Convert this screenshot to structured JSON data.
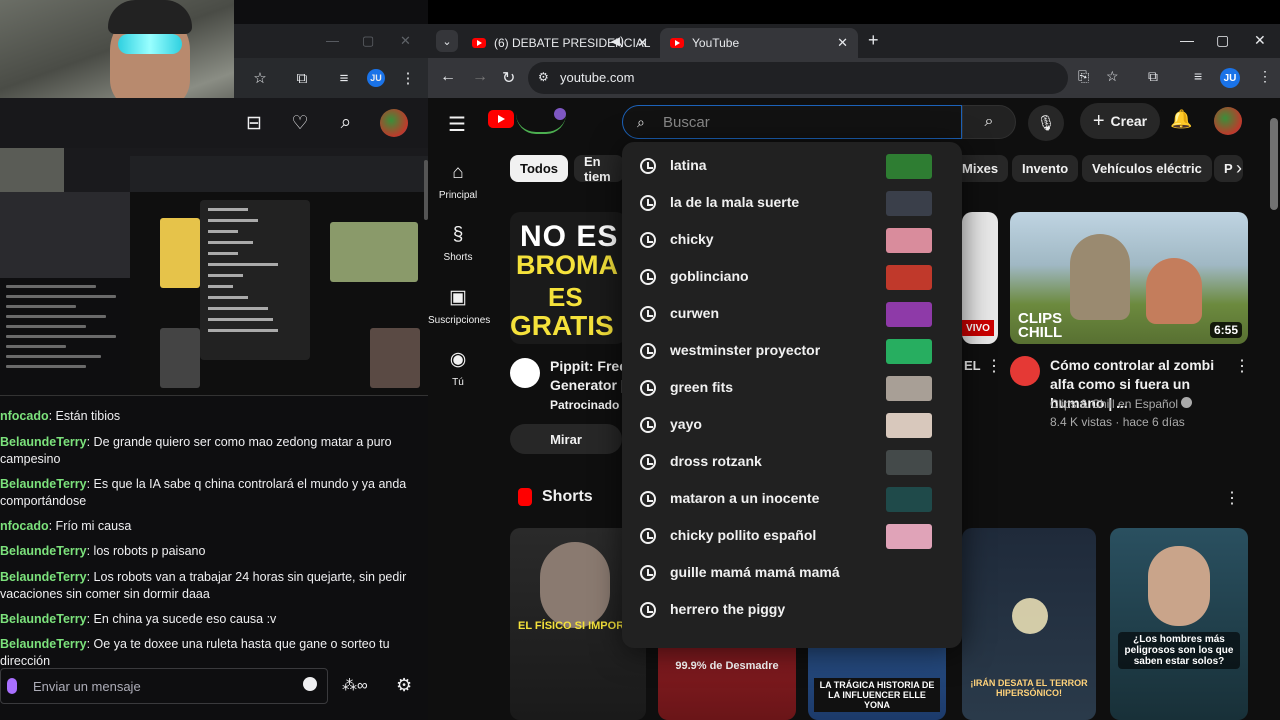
{
  "left": {
    "tabbar_controls": [
      "—",
      "▢",
      "✕"
    ],
    "toolbar_profile": "JU",
    "chat": [
      {
        "user": "nfocado",
        "text": ": Están tibios"
      },
      {
        "user": "BelaundeTerry",
        "text": ": De grande quiero ser como mao zedong matar a puro campesino"
      },
      {
        "user": "BelaundeTerry",
        "text": ": Es que la IA sabe q china controlará el mundo y ya anda comportándose"
      },
      {
        "user": "nfocado",
        "text": ": Frío mi causa"
      },
      {
        "user": "BelaundeTerry",
        "text": ": los robots p paisano"
      },
      {
        "user": "BelaundeTerry",
        "text": ": Los robots van a trabajar 24 horas sin quejarte, sin pedir vacaciones sin comer sin dormir daaa"
      },
      {
        "user": "BelaundeTerry",
        "text": ": En china ya sucede eso causa :v"
      },
      {
        "user": "BelaundeTerry",
        "text": ": Oe ya te doxee una ruleta hasta que gane o sorteo tu dirección"
      }
    ],
    "chat_placeholder": "Enviar un mensaje"
  },
  "browser": {
    "tabs": [
      {
        "title": "(6) DEBATE PRESIDENCIAL",
        "active": false
      },
      {
        "title": "YouTube",
        "active": true
      }
    ],
    "url": "youtube.com",
    "profile": "JU"
  },
  "youtube": {
    "search_placeholder": "Buscar",
    "crear_label": "Crear",
    "guide": [
      {
        "icon": "home-icon",
        "label": "Principal"
      },
      {
        "icon": "shorts-icon",
        "label": "Shorts"
      },
      {
        "icon": "subscriptions-icon",
        "label": "Suscripciones"
      },
      {
        "icon": "you-icon",
        "label": "Tú"
      }
    ],
    "chips": {
      "first": "Todos",
      "second": "En tiem",
      "mixes": "Mixes",
      "invento": "Invento",
      "vehiculos": "Vehículos eléctric",
      "last": "P"
    },
    "suggestions": [
      "latina",
      "la de la mala suerte",
      "chicky",
      "goblinciano",
      "curwen",
      "westminster proyector",
      "green fits",
      "yayo",
      "dross rotzank",
      "mataron a un inocente",
      "chicky pollito español",
      "guille mamá mamá mamá",
      "herrero the piggy"
    ],
    "ad": {
      "thumb_text_1": "NO ES",
      "thumb_text_2": "BROMA",
      "thumb_text_3": "ES",
      "thumb_text_4": "GRATIS",
      "title_line1": "Pippit: Free",
      "title_line2": "Generator | Y",
      "sponsored": "Patrocinado",
      "cta": "Mirar"
    },
    "live_badge": "VIVO",
    "live_title_fragment": "EL",
    "video": {
      "duration": "6:55",
      "thumb_text": "CLIPS CHILL",
      "title": "Cómo controlar al zombi alfa como si fuera un humano | ...",
      "channel": "Clips & Chill en Español",
      "meta": "8.4 K vistas · hace 6 días"
    },
    "shorts_label": "Shorts",
    "shorts_captions": [
      "EL FÍSICO SI IMPORTA",
      "99.9% de Desmadre",
      "LA TRÁGICA HISTORIA DE LA INFLUENCER ELLE YONA",
      "¡IRÁN DESATA EL TERROR HIPERSÓNICO!",
      "¿Los hombres más peligrosos son los que saben estar solos?"
    ]
  }
}
